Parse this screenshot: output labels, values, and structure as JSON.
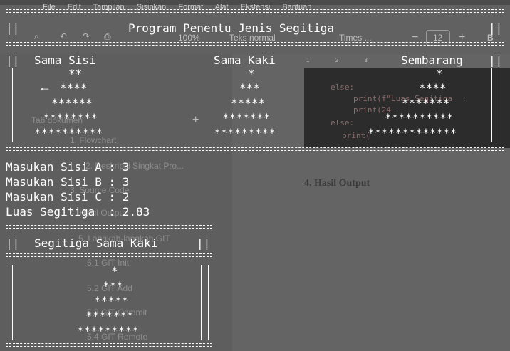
{
  "background_app": {
    "menu": [
      "File",
      "Edit",
      "Tampilan",
      "Sisipkan",
      "Format",
      "Alat",
      "Ekstensi",
      "Bantuan"
    ],
    "toolbar": {
      "zoom": "100%",
      "style": "Teks normal",
      "font": "Times ...",
      "font_size": "12",
      "minus": "−",
      "plus": "+",
      "bold": "B"
    },
    "ruler": [
      "1",
      "2",
      "3"
    ],
    "tab_dokumen": "Tab dokumen",
    "outline": [
      "1. Flowchart",
      "2. Deskripsi Singkat Pro...",
      "3. Source Code",
      "4. Hasil Output",
      "5. Langkah-langkah GIT",
      "5.1 GIT Init",
      "5.2 GIT Add",
      "5.3 GIT Commit",
      "5.4 GIT Remote"
    ],
    "heading_hasil": "4. Hasil Output",
    "code_lines": [
      "else:",
      "print(f\"Luas Segitiga  :",
      "print(24",
      "else:",
      "print("
    ]
  },
  "terminal": {
    "title": "Program Penentu Jenis Segitiga",
    "headers": [
      "Sama Sisi",
      "Sama Kaki",
      "Sembarang"
    ],
    "sama_sisi": [
      "**",
      "****",
      "******",
      "********",
      "**********"
    ],
    "sama_kaki": [
      "*",
      "***",
      "*****",
      "*******",
      "*********"
    ],
    "sembarang": [
      "*",
      "****",
      "*******",
      "**********",
      "*************"
    ],
    "inputs": [
      {
        "label": "Masukan Sisi A : ",
        "value": "3"
      },
      {
        "label": "Masukan Sisi B : ",
        "value": "3"
      },
      {
        "label": "Masukan Sisi C : ",
        "value": "2"
      },
      {
        "label": "Luas Segitiga  : ",
        "value": "2.83"
      }
    ],
    "result_title": "Segitiga Sama Kaki",
    "result_stars": [
      "*",
      "***",
      "*****",
      "*******",
      "*********"
    ],
    "pipes": "||",
    "equals_line": "=============================================================================",
    "equals_short": "========================"
  }
}
